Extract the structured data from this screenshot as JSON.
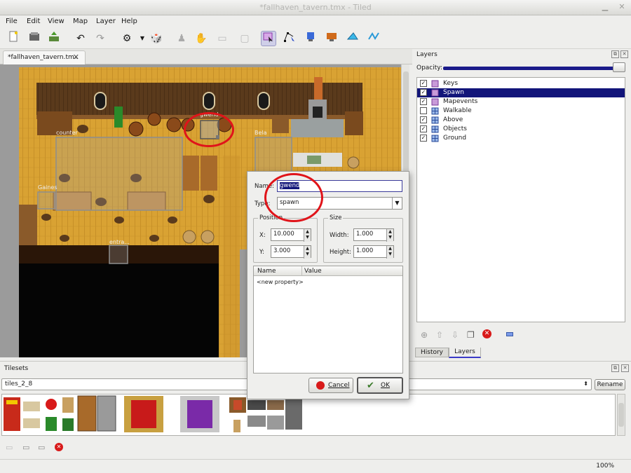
{
  "window": {
    "title": "*fallhaven_tavern.tmx - Tiled"
  },
  "menu": [
    "File",
    "Edit",
    "View",
    "Map",
    "Layer",
    "Help"
  ],
  "toolbar": {
    "icons": [
      "new-icon",
      "open-icon",
      "save-icon",
      "undo-icon",
      "redo-icon",
      "stamp-brush-icon",
      "random-icon",
      "bucket-fill-icon",
      "eraser-icon",
      "rect-select-icon",
      "select-objects-icon",
      "edit-polygons-icon",
      "insert-rectangle-icon",
      "insert-image-icon",
      "insert-polygon-icon",
      "insert-polyline-icon"
    ]
  },
  "document_tab": {
    "label": "*fallhaven_tavern.tmx"
  },
  "map": {
    "object_labels": [
      "gwend",
      "Bela",
      "counter",
      "Gaines",
      "entra..."
    ]
  },
  "layers_panel": {
    "title": "Layers",
    "opacity_label": "Opacity:",
    "opacity": 1.0,
    "layers": [
      {
        "name": "Keys",
        "checked": true,
        "type": "object",
        "selected": false
      },
      {
        "name": "Spawn",
        "checked": true,
        "type": "object",
        "selected": true
      },
      {
        "name": "Mapevents",
        "checked": true,
        "type": "object",
        "selected": false
      },
      {
        "name": "Walkable",
        "checked": false,
        "type": "tile",
        "selected": false
      },
      {
        "name": "Above",
        "checked": true,
        "type": "tile",
        "selected": false
      },
      {
        "name": "Objects",
        "checked": true,
        "type": "tile",
        "selected": false
      },
      {
        "name": "Ground",
        "checked": true,
        "type": "tile",
        "selected": false
      }
    ],
    "tabs": [
      "History",
      "Layers"
    ],
    "active_tab": "Layers"
  },
  "tilesets_panel": {
    "title": "Tilesets",
    "selected_tileset": "tiles_2_8",
    "rename_label": "Rename"
  },
  "status": {
    "zoom": "100%"
  },
  "dialog": {
    "name_label": "Name:",
    "name_value": "gwend",
    "type_label": "Type:",
    "type_value": "spawn",
    "position_title": "Position",
    "x_label": "X:",
    "x_value": "10.000",
    "y_label": "Y:",
    "y_value": "3.000",
    "size_title": "Size",
    "width_label": "Width:",
    "width_value": "1.000",
    "height_label": "Height:",
    "height_value": "1.000",
    "props_col_name": "Name",
    "props_col_value": "Value",
    "new_property": "<new property>",
    "cancel_label": "Cancel",
    "ok_label": "OK"
  },
  "colors": {
    "selection": "#12157a",
    "annotation_red": "#e0141a",
    "floor": "#d9a233",
    "void": "#050505"
  }
}
